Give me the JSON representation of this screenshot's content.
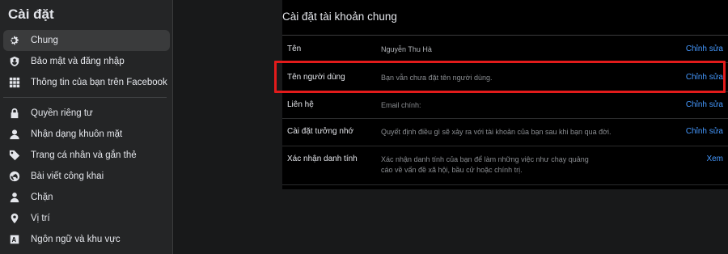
{
  "sidebar": {
    "title": "Cài đặt",
    "items": [
      {
        "label": "Chung",
        "icon": "gear-icon",
        "active": true
      },
      {
        "label": "Bảo mật và đăng nhập",
        "icon": "shield-icon"
      },
      {
        "label": "Thông tin của bạn trên Facebook",
        "icon": "grid-icon"
      },
      {
        "label": "Quyền riêng tư",
        "icon": "lock-icon"
      },
      {
        "label": "Nhận dạng khuôn mặt",
        "icon": "face-icon"
      },
      {
        "label": "Trang cá nhân và gắn thẻ",
        "icon": "tag-icon"
      },
      {
        "label": "Bài viết công khai",
        "icon": "globe-icon"
      },
      {
        "label": "Chặn",
        "icon": "block-user-icon"
      },
      {
        "label": "Vị trí",
        "icon": "location-pin-icon"
      },
      {
        "label": "Ngôn ngữ và khu vực",
        "icon": "language-icon"
      }
    ]
  },
  "main": {
    "title": "Cài đặt tài khoản chung",
    "rows": [
      {
        "label": "Tên",
        "value": "Nguyễn Thu Hà",
        "action": "Chỉnh sửa"
      },
      {
        "label": "Tên người dùng",
        "value": "Bạn vẫn chưa đặt tên người dùng.",
        "action": "Chỉnh sửa"
      },
      {
        "label": "Liên hệ",
        "value": "Email chính:",
        "action": "Chỉnh sửa"
      },
      {
        "label": "Cài đặt tưởng nhớ",
        "value": "Quyết định điều gì sẽ xảy ra với tài khoản của bạn sau khi bạn qua đời.",
        "action": "Chỉnh sửa"
      },
      {
        "label": "Xác nhận danh tính",
        "value_line1": "Xác nhận danh tính của bạn để làm những việc như chạy quảng",
        "value_line2": "cáo về vấn đề xã hội, bầu cử hoặc chính trị.",
        "action": "Xem"
      }
    ]
  },
  "colors": {
    "background": "#18191a",
    "sidebar": "#242526",
    "panel": "#000000",
    "link": "#4599ff",
    "highlight": "#e21b1b"
  }
}
